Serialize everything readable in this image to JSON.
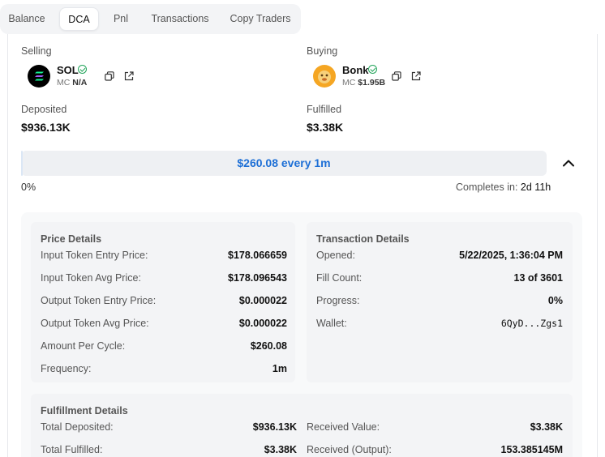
{
  "tabs": [
    {
      "label": "Balance",
      "active": false
    },
    {
      "label": "DCA",
      "active": true
    },
    {
      "label": "Pnl",
      "active": false
    },
    {
      "label": "Transactions",
      "active": false
    },
    {
      "label": "Copy Traders",
      "active": false
    }
  ],
  "selling": {
    "label": "Selling",
    "token": "SOL",
    "mc_label": "MC",
    "mc_value": "N/A"
  },
  "buying": {
    "label": "Buying",
    "token": "Bonk",
    "mc_label": "MC",
    "mc_value": "$1.95B"
  },
  "deposited": {
    "label": "Deposited",
    "value": "$936.13K"
  },
  "fulfilled": {
    "label": "Fulfilled",
    "value": "$3.38K"
  },
  "progress": {
    "text": "$260.08 every 1m",
    "percent_label": "0%",
    "fraction": 0.0036,
    "completes_label": "Completes in:",
    "completes_value": "2d 11h"
  },
  "price_details": {
    "title": "Price Details",
    "rows": [
      {
        "label": "Input Token Entry Price:",
        "value": "$178.066659"
      },
      {
        "label": "Input Token Avg Price:",
        "value": "$178.096543"
      },
      {
        "label": "Output Token Entry Price:",
        "value": "$0.000022"
      },
      {
        "label": "Output Token Avg Price:",
        "value": "$0.000022"
      },
      {
        "label": "Amount Per Cycle:",
        "value": "$260.08"
      },
      {
        "label": "Frequency:",
        "value": "1m"
      }
    ]
  },
  "transaction_details": {
    "title": "Transaction Details",
    "rows": [
      {
        "label": "Opened:",
        "value": "5/22/2025, 1:36:04 PM"
      },
      {
        "label": "Fill Count:",
        "value": "13 of 3601"
      },
      {
        "label": "Progress:",
        "value": "0%"
      },
      {
        "label": "Wallet:",
        "value": "6QyD...Zgs1"
      }
    ]
  },
  "fulfillment_details": {
    "title": "Fulfillment Details",
    "left": [
      {
        "label": "Total Deposited:",
        "value": "$936.13K"
      },
      {
        "label": "Total Fulfilled:",
        "value": "$3.38K"
      }
    ],
    "right": [
      {
        "label": "Received Value:",
        "value": "$3.38K"
      },
      {
        "label": "Received (Output):",
        "value": "153.385145M"
      }
    ]
  },
  "colors": {
    "accent": "#1d6fd6",
    "verified": "#22a45a",
    "sol_logo": "#000000",
    "bonk_logo": "#f5a623"
  }
}
